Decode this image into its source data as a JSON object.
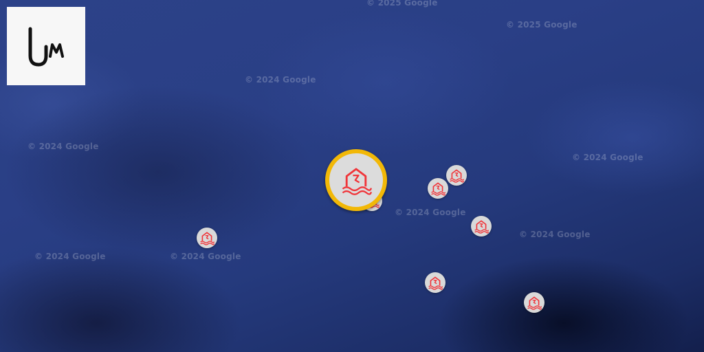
{
  "map": {
    "base_color": "#2a3f86",
    "watermarks": [
      "© 2025 Google",
      "© 2025 Google",
      "© 2024 Google",
      "© 2024 Google",
      "© 2024 Google",
      "© 2024 Google",
      "© 2024 Google",
      "© 2024 Google",
      "© 2024 Google"
    ]
  },
  "logo": {
    "icon": "um-logo",
    "background": "#f7f7f7",
    "stroke": "#111111"
  },
  "markers": {
    "icon": "house-flood-icon",
    "icon_color": "#f0353a",
    "marker_fill": "#d9d9d9",
    "selected_ring_color": "#f2b807",
    "count": 8
  }
}
